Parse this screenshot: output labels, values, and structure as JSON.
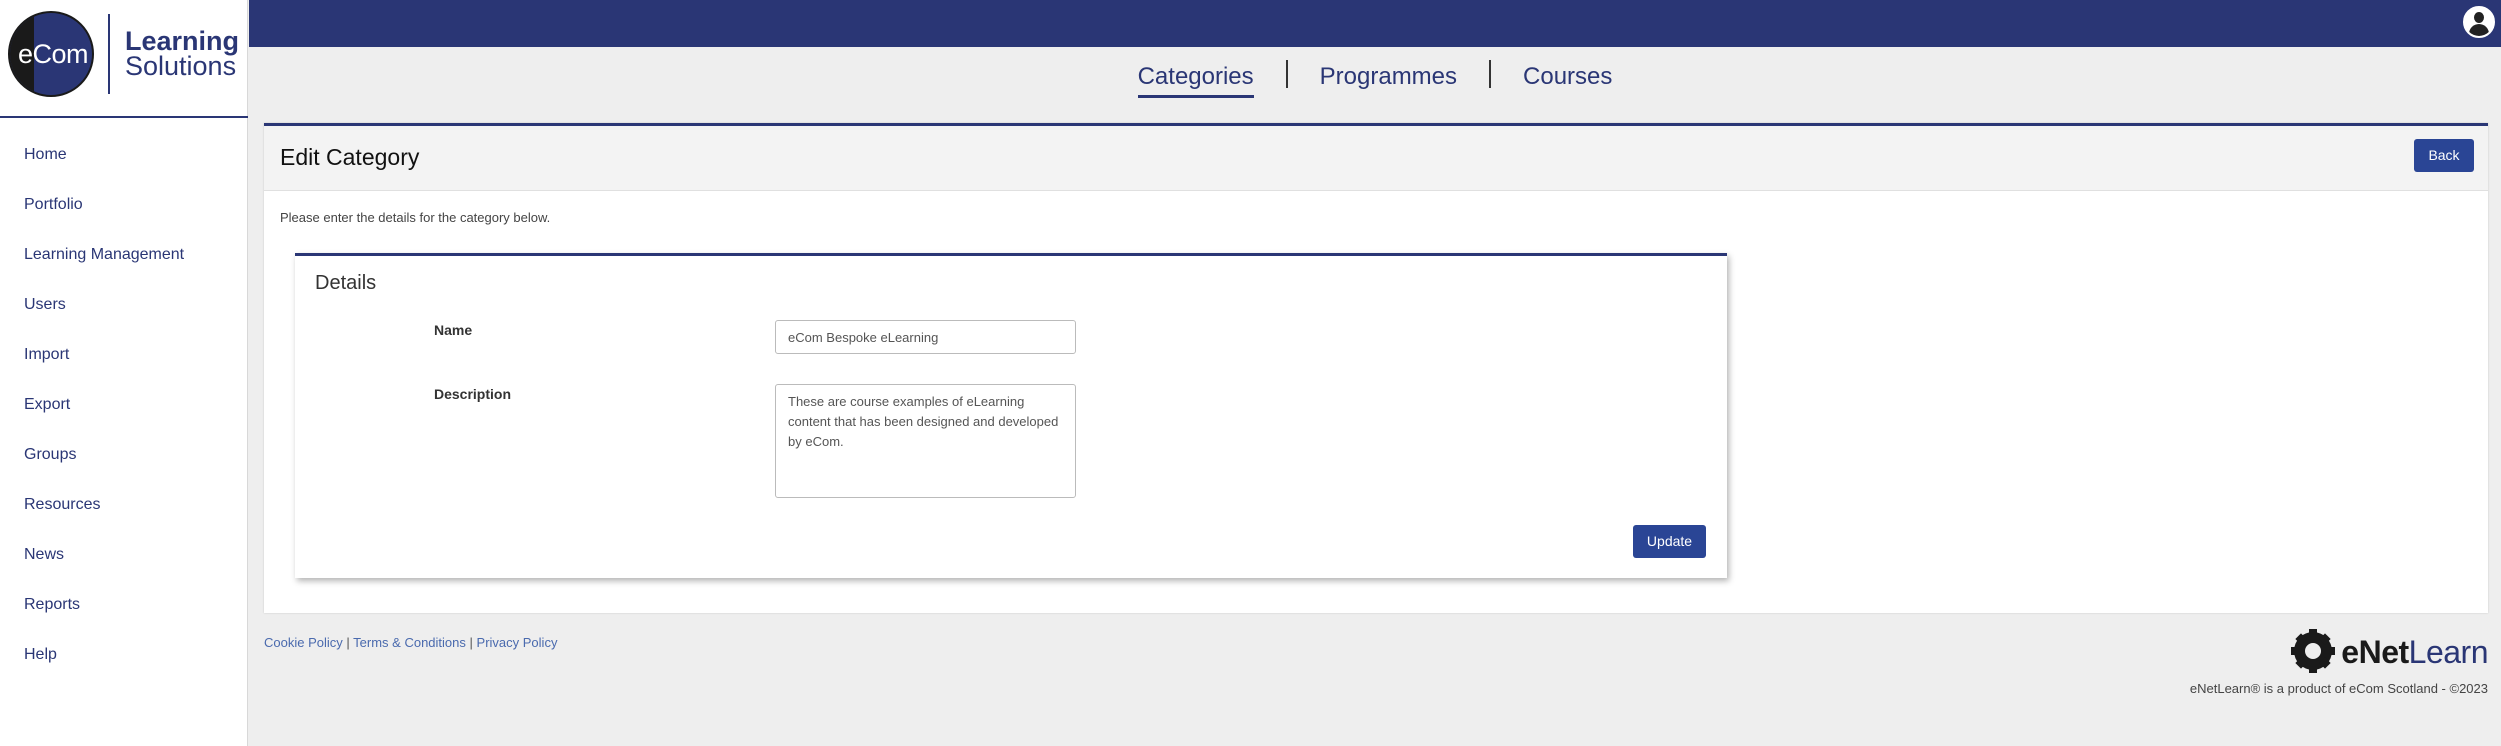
{
  "logo": {
    "circle_text": "eCom",
    "line1": "Learning",
    "line2": "Solutions"
  },
  "sidebar": {
    "items": [
      {
        "label": "Home"
      },
      {
        "label": "Portfolio"
      },
      {
        "label": "Learning Management"
      },
      {
        "label": "Users"
      },
      {
        "label": "Import"
      },
      {
        "label": "Export"
      },
      {
        "label": "Groups"
      },
      {
        "label": "Resources"
      },
      {
        "label": "News"
      },
      {
        "label": "Reports"
      },
      {
        "label": "Help"
      }
    ]
  },
  "tabs": [
    {
      "label": "Categories",
      "active": true
    },
    {
      "label": "Programmes",
      "active": false
    },
    {
      "label": "Courses",
      "active": false
    }
  ],
  "panel": {
    "title": "Edit Category",
    "back_label": "Back",
    "intro": "Please enter the details for the category below."
  },
  "details": {
    "title": "Details",
    "name_label": "Name",
    "name_value": "eCom Bespoke eLearning",
    "description_label": "Description",
    "description_value": "These are course examples of eLearning content that has been designed and developed by eCom.",
    "update_label": "Update"
  },
  "footer": {
    "cookie": "Cookie Policy",
    "sep": "|",
    "terms": "Terms & Conditions",
    "privacy": "Privacy Policy",
    "brand_e": "e",
    "brand_net": "Net",
    "brand_learn": "Learn",
    "copyright": "eNetLearn® is a product of eCom Scotland - ©2023"
  },
  "colors": {
    "primary": "#2a3675",
    "button": "#2a4595",
    "background": "#eeeeee"
  },
  "icons": {
    "user": "user-avatar-icon",
    "brand": "gear-icon"
  }
}
